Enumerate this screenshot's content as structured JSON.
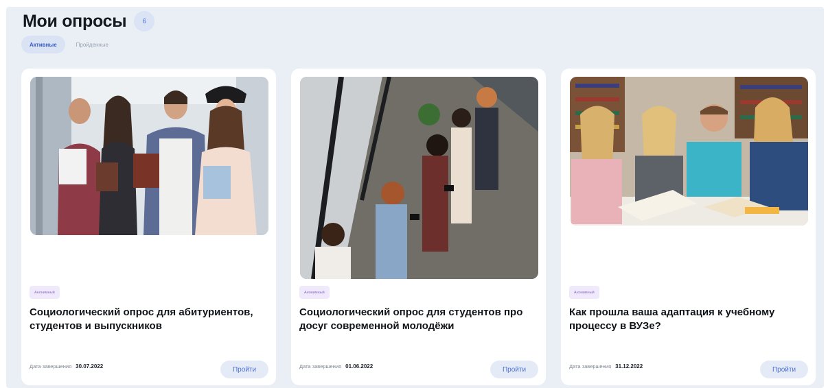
{
  "page": {
    "title": "Мои опросы",
    "count": "6"
  },
  "tabs": [
    {
      "label": "Активные",
      "active": true
    },
    {
      "label": "Пройденные",
      "active": false
    }
  ],
  "cards": [
    {
      "image": "students-with-books-photo",
      "badge": "Анонимный",
      "title": "Социологический опрос для абитуриентов, студентов и выпускников",
      "date_label": "Дата завершения",
      "date": "30.07.2022",
      "button": "Пройти"
    },
    {
      "image": "young-people-with-phones-photo",
      "badge": "Анонимный",
      "title": "Социологический опрос для студентов про досуг современной молодёжи",
      "date_label": "Дата завершения",
      "date": "01.06.2022",
      "button": "Пройти"
    },
    {
      "image": "students-studying-in-library-photo",
      "badge": "Анонимный",
      "title": "Как прошла ваша адаптация к учебному процессу в ВУЗе?",
      "date_label": "Дата завершения",
      "date": "31.12.2022",
      "button": "Пройти"
    }
  ],
  "colors": {
    "background": "#eaeff6",
    "card": "#ffffff",
    "accent": "#4b6fd6",
    "badge_bg": "#efe9fb",
    "badge_text": "#8b6dc7"
  }
}
